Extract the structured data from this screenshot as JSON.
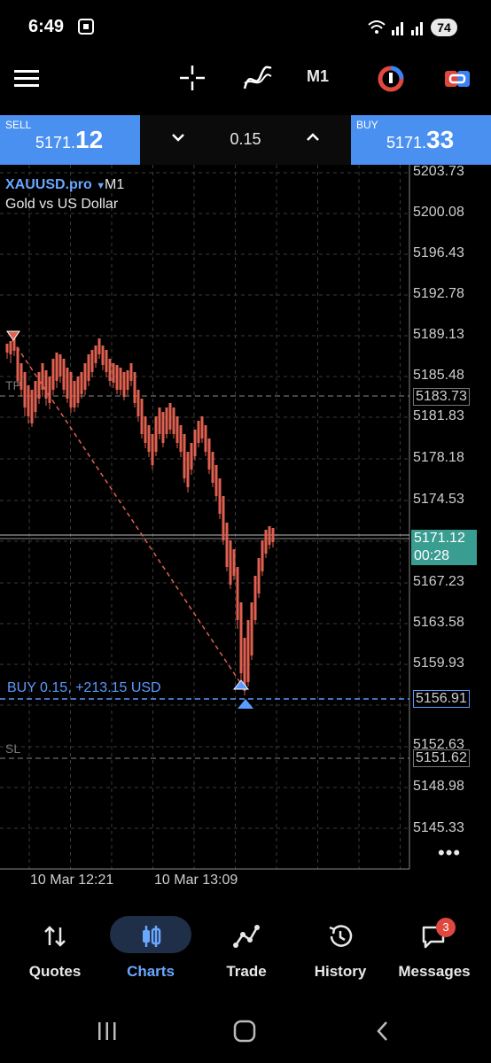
{
  "status_bar": {
    "time": "6:49",
    "battery": "74",
    "icons": [
      "screenshot-icon",
      "wifi-icon",
      "signal-icon",
      "signal-icon-2"
    ]
  },
  "toolbar": {
    "timeframe": "M1",
    "icons": [
      "menu-icon",
      "crosshair-icon",
      "indicators-icon",
      "objects-icon",
      "trade-toggle-icon"
    ]
  },
  "trade_panel": {
    "sell_label": "SELL",
    "sell_price_prefix": "5171.",
    "sell_price_big": "12",
    "volume": "0.15",
    "buy_label": "BUY",
    "buy_price_prefix": "5171.",
    "buy_price_big": "33"
  },
  "chart": {
    "symbol": "XAUUSD.pro",
    "timeframe": "M1",
    "description": "Gold vs US Dollar",
    "price_axis": [
      "5203.73",
      "5200.08",
      "5196.43",
      "5192.78",
      "5189.13",
      "5185.48",
      "5181.83",
      "5178.18",
      "5174.53",
      "5167.23",
      "5163.58",
      "5159.93",
      "5152.63",
      "5148.98",
      "5145.33"
    ],
    "tp_price": "5183.73",
    "current_price": "5171.12",
    "countdown": "00:28",
    "position_price": "5156.91",
    "sl_price": "5151.62",
    "tp_label": "TP",
    "sl_label": "SL",
    "position_label": "BUY 0.15,  +213.15 USD",
    "time_axis": [
      "10 Mar 12:21",
      "10 Mar 13:09"
    ],
    "more": "•••",
    "colors": {
      "up": "#2fb59a",
      "down": "#e06050",
      "buy_line": "#5b9bff",
      "current": "#3a9d92"
    }
  },
  "bottom_nav": {
    "items": [
      {
        "label": "Quotes",
        "icon": "quotes-icon"
      },
      {
        "label": "Charts",
        "icon": "charts-icon"
      },
      {
        "label": "Trade",
        "icon": "trade-icon"
      },
      {
        "label": "History",
        "icon": "history-icon"
      },
      {
        "label": "Messages",
        "icon": "messages-icon"
      }
    ],
    "messages_badge": "3",
    "active": "Charts"
  },
  "system_nav": {
    "icons": [
      "recents-icon",
      "home-icon",
      "back-icon"
    ]
  }
}
